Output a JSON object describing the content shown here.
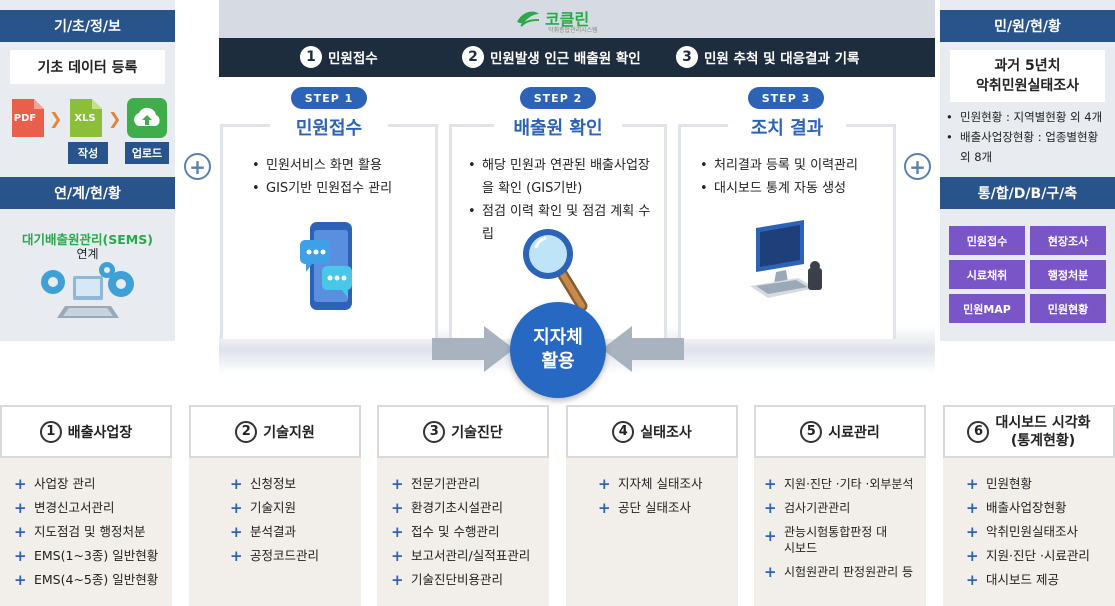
{
  "left_panel": {
    "header1": "기/초/정/보",
    "box1": "기초 데이터 등록",
    "file_icons": [
      "PDF",
      "XLS"
    ],
    "buttons": [
      "작성",
      "업로드"
    ],
    "header2": "연/계/현/황",
    "sems_title": "대기배출원관리(SEMS)",
    "sems_sub": "연계"
  },
  "center": {
    "logo_text": "코클린",
    "logo_sub": "악취종합관리시스템",
    "top_steps": [
      {
        "num": "1",
        "label": "민원접수"
      },
      {
        "num": "2",
        "label": "민원발생 인근 배출원 확인"
      },
      {
        "num": "3",
        "label": "민원 추척 및 대응결과 기록"
      }
    ],
    "cards": [
      {
        "step": "STEP 1",
        "title": "민원접수",
        "bullets": [
          "민원서비스 화면 활용",
          "GIS기반 민원접수 관리"
        ]
      },
      {
        "step": "STEP 2",
        "title": "배출원 확인",
        "bullets": [
          "해당 민원과 연관된 배출사업장을 확인 (GIS기반)",
          "점검 이력 확인 및 점검 계획 수립"
        ]
      },
      {
        "step": "STEP 3",
        "title": "조치 결과",
        "bullets": [
          "처리결과 등록 및 이력관리",
          "대시보드 통계 자동 생성"
        ]
      }
    ],
    "hub_line1": "지자체",
    "hub_line2": "활용"
  },
  "right_panel": {
    "header1": "민/원/현/황",
    "box_title_l1": "과거 5년치",
    "box_title_l2": "악취민원실태조사",
    "bullets": [
      "민원현황 : 지역별현황 외 4개",
      "배출사업장현황 : 업종별현황 외 8개"
    ],
    "header2": "통/합/D/B/구/축",
    "grid": [
      "민원접수",
      "현장조사",
      "시료채취",
      "행정처분",
      "민원MAP",
      "민원현황"
    ]
  },
  "bottom": [
    {
      "num": "1",
      "title": "배출사업장",
      "items": [
        "사업장 관리",
        "변경신고서관리",
        "지도점검 및 행정처분",
        "EMS(1~3종) 일반현황",
        "EMS(4~5종) 일반현황"
      ]
    },
    {
      "num": "2",
      "title": "기술지원",
      "items": [
        "신청정보",
        "기술지원",
        "분석결과",
        "공정코드관리"
      ]
    },
    {
      "num": "3",
      "title": "기술진단",
      "items": [
        "전문기관관리",
        "환경기초시설관리",
        "접수 및 수행관리",
        "보고서관리/실적표관리",
        "기술진단비용관리"
      ]
    },
    {
      "num": "4",
      "title": "실태조사",
      "items": [
        "지자체 실태조사",
        "공단 실태조사"
      ]
    },
    {
      "num": "5",
      "title": "시료관리",
      "items": [
        "지원·진단 ·기타 ·외부분석",
        "검사기관관리",
        "관능시험통합판정 대시보드",
        "시험원관리 판정원관리 등"
      ]
    },
    {
      "num": "6",
      "title_l1": "대시보드 시각화",
      "title_l2": "(통계현황)",
      "items": [
        "민원현황",
        "배출사업장현황",
        "악취민원실태조사",
        "지원·진단 ·시료관리",
        "대시보드 제공"
      ]
    }
  ],
  "colors": {
    "navy": "#1e2d3d",
    "blue": "#2d63b6",
    "purple": "#7a55c8",
    "green": "#2aa84a",
    "header_blue": "#29538b"
  }
}
